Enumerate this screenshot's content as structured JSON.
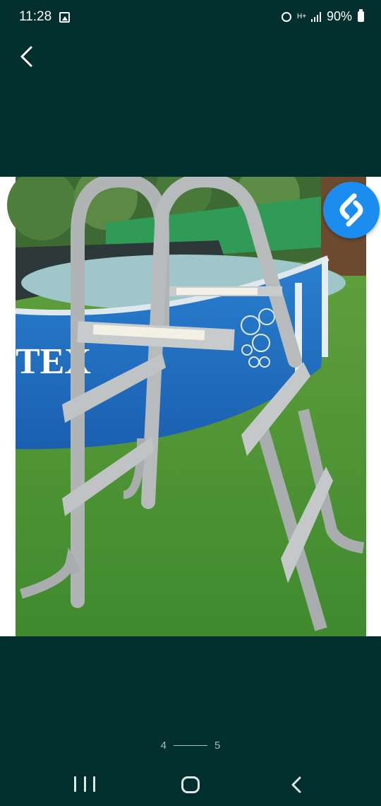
{
  "status_bar": {
    "time": "11:28",
    "network": "H+",
    "battery": "90%",
    "icons": [
      "gallery-icon",
      "alarm-icon",
      "network-icon",
      "signal-icon",
      "battery-icon"
    ]
  },
  "header": {
    "back_icon": "chevron-left-icon"
  },
  "photo": {
    "subject": "pool ladder next to above-ground pool",
    "brand_text": "TEX",
    "overlay_button": "shazam-icon"
  },
  "pager": {
    "current": "4",
    "total": "5"
  },
  "nav_bar": {
    "icons": [
      "recent-apps-icon",
      "home-icon",
      "back-icon"
    ]
  },
  "colors": {
    "background": "#012f2e",
    "shazam_blue": "#1b8cf0"
  }
}
